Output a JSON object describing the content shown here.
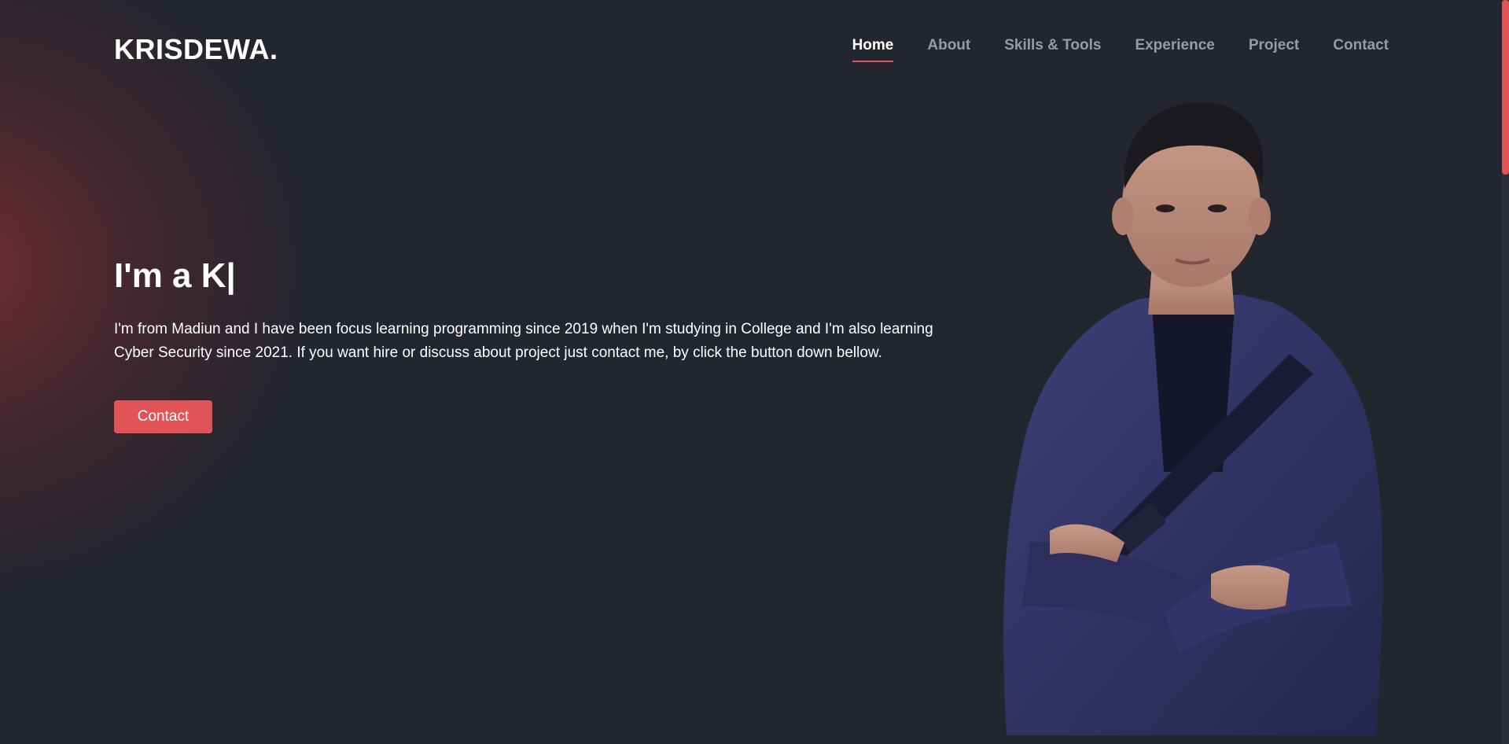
{
  "brand": {
    "logo_text": "KRISDEWA."
  },
  "nav": {
    "items": [
      {
        "label": "Home",
        "active": true
      },
      {
        "label": "About",
        "active": false
      },
      {
        "label": "Skills & Tools",
        "active": false
      },
      {
        "label": "Experience",
        "active": false
      },
      {
        "label": "Project",
        "active": false
      },
      {
        "label": "Contact",
        "active": false
      }
    ]
  },
  "hero": {
    "title": "I'm a K|",
    "description": "I'm from Madiun and I have been focus learning programming since 2019 when I'm studying in College and I'm also learning Cyber Security since 2021. If you want hire or discuss about project just contact me, by click the button down bellow.",
    "button_label": "Contact"
  },
  "colors": {
    "background": "#23262e",
    "accent": "#e05458",
    "nav_inactive": "#9a9ba0",
    "text": "#ffffff"
  },
  "portrait": {
    "subject": "portrait-photo"
  }
}
